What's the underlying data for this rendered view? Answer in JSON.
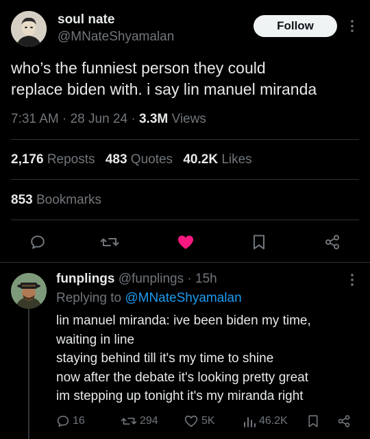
{
  "tweet": {
    "author": {
      "name": "soul nate",
      "handle": "@MNateShyamalan"
    },
    "follow_label": "Follow",
    "text_lines": [
      "who’s the funniest person they could",
      "replace biden with. i say lin manuel miranda"
    ],
    "meta": {
      "time": "7:31 AM",
      "dot1": "·",
      "date": "28 Jun 24",
      "dot2": "·",
      "views_count": "3.3M",
      "views_label": "Views"
    },
    "stats": {
      "reposts_count": "2,176",
      "reposts_label": "Reposts",
      "quotes_count": "483",
      "quotes_label": "Quotes",
      "likes_count": "40.2K",
      "likes_label": "Likes",
      "bookmarks_count": "853",
      "bookmarks_label": "Bookmarks"
    },
    "actions": [
      "reply-icon",
      "repost-icon",
      "like-icon",
      "bookmark-icon",
      "share-icon"
    ],
    "liked": true
  },
  "reply": {
    "author": {
      "name": "funplings",
      "handle": "@funplings",
      "dot": "·",
      "age": "15h"
    },
    "replying_to_label": "Replying to",
    "replying_to_handle": "@MNateShyamalan",
    "text_lines": [
      "lin manuel miranda: ive been biden my time,",
      "waiting in line",
      "staying behind till it's my time to shine",
      "now after the debate it's looking pretty great",
      "im stepping up tonight it's my miranda right"
    ],
    "actions": {
      "replies": "16",
      "reposts": "294",
      "likes": "5K",
      "views": "46.2K"
    }
  },
  "colors": {
    "background": "#000000",
    "text": "#e7e9ea",
    "muted": "#71767b",
    "link": "#1d9bf0",
    "like": "#f91880",
    "divider": "#2f3336"
  }
}
